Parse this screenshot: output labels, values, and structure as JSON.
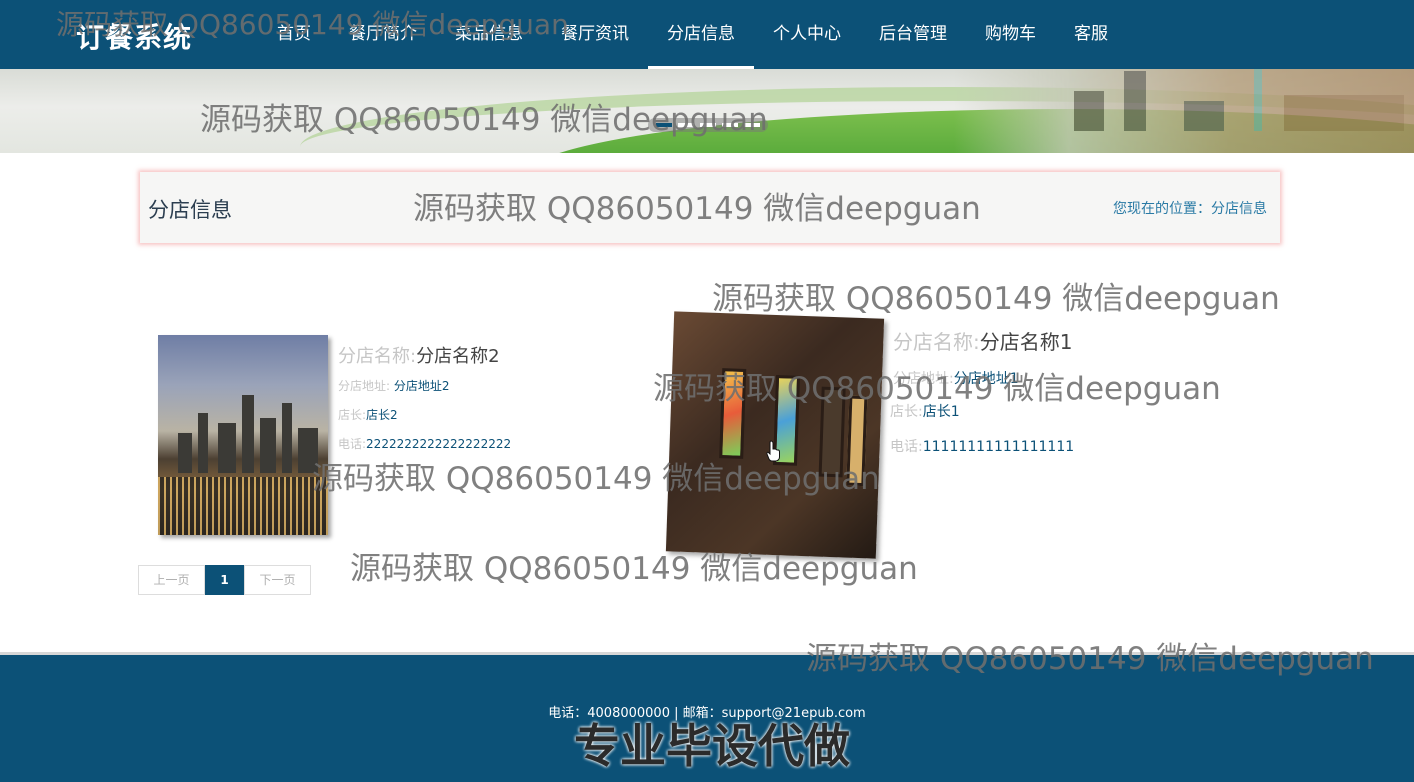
{
  "header": {
    "brand": "订餐系统",
    "nav": [
      {
        "label": "首页",
        "active": false
      },
      {
        "label": "餐厅简介",
        "active": false
      },
      {
        "label": "菜品信息",
        "active": false
      },
      {
        "label": "餐厅资讯",
        "active": false
      },
      {
        "label": "分店信息",
        "active": true
      },
      {
        "label": "个人中心",
        "active": false
      },
      {
        "label": "后台管理",
        "active": false
      },
      {
        "label": "购物车",
        "active": false
      },
      {
        "label": "客服",
        "active": false
      }
    ]
  },
  "banner": {
    "slides": 5,
    "active_slide": 1
  },
  "breadcrumb": {
    "title": "分店信息",
    "location": "您现在的位置：分店信息"
  },
  "stores": [
    {
      "name_label": "分店名称:",
      "name": "分店名称2",
      "address_label": "分店地址:",
      "address": "分店地址2",
      "manager_label": "店长:",
      "manager": "店长2",
      "phone_label": "电话:",
      "phone": "2222222222222222222",
      "image_icon": "city-skyline-photo"
    },
    {
      "name_label": "分店名称:",
      "name": "分店名称1",
      "address_label": "分店地址:",
      "address": "分店地址1",
      "manager_label": "店长:",
      "manager": "店长1",
      "phone_label": "电话:",
      "phone": "11111111111111111",
      "image_icon": "brick-building-photo"
    }
  ],
  "pager": {
    "prev": "上一页",
    "current": "1",
    "next": "下一页"
  },
  "footer": {
    "contact": "电话：4008000000 | 邮箱：support@21epub.com",
    "overlay_text": "专业毕设代做"
  },
  "watermarks": [
    "源码获取 QQ86050149 微信deepguan",
    "源码获取 QQ86050149 微信deepguan",
    "源码获取 QQ86050149 微信deepguan",
    "源码获取 QQ86050149 微信deepguan",
    "源码获取 QQ86050149 微信deepguan",
    "源码获取 QQ86050149 微信deepguan",
    "源码获取 QQ86050149 微信deepguan",
    "源码获取 QQ86050149 微信deepguan"
  ],
  "colors": {
    "primary": "#0c5177",
    "link": "#2a7aa5",
    "label_gray": "#c6c6c6"
  }
}
